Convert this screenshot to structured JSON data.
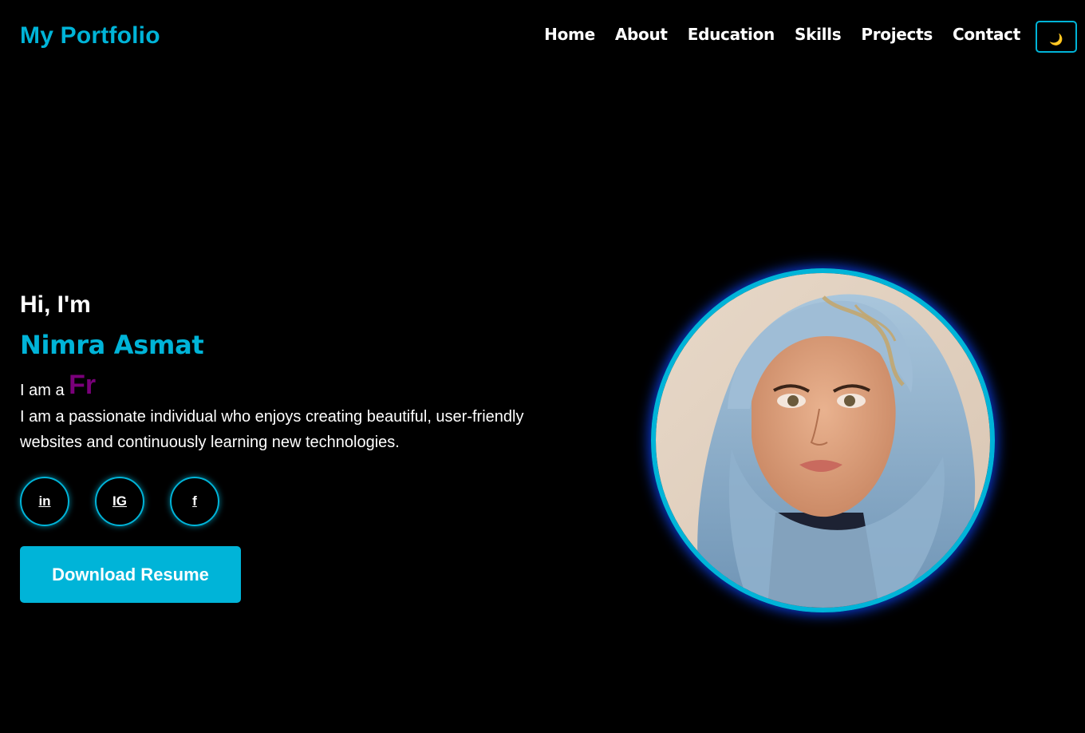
{
  "header": {
    "logo": "My Portfolio",
    "nav": [
      {
        "label": "Home"
      },
      {
        "label": "About"
      },
      {
        "label": "Education"
      },
      {
        "label": "Skills"
      },
      {
        "label": "Projects"
      },
      {
        "label": "Contact"
      }
    ],
    "theme_toggle_icon": "moon-icon"
  },
  "hero": {
    "greeting": "Hi, I'm",
    "name": "Nimra Asmat",
    "role_prefix": "I am a",
    "role_typed": "Fr",
    "bio": "I am a passionate individual who enjoys creating beautiful, user-friendly websites and continuously learning new technologies.",
    "socials": [
      {
        "label": "in",
        "icon": "linkedin-icon"
      },
      {
        "label": "IG",
        "icon": "instagram-icon"
      },
      {
        "label": "f",
        "icon": "facebook-icon"
      }
    ],
    "download_label": "Download Resume"
  },
  "colors": {
    "accent": "#00b4d8",
    "typed_text": "#7a007a",
    "background": "#000000",
    "glow": "#0b3bd6"
  }
}
